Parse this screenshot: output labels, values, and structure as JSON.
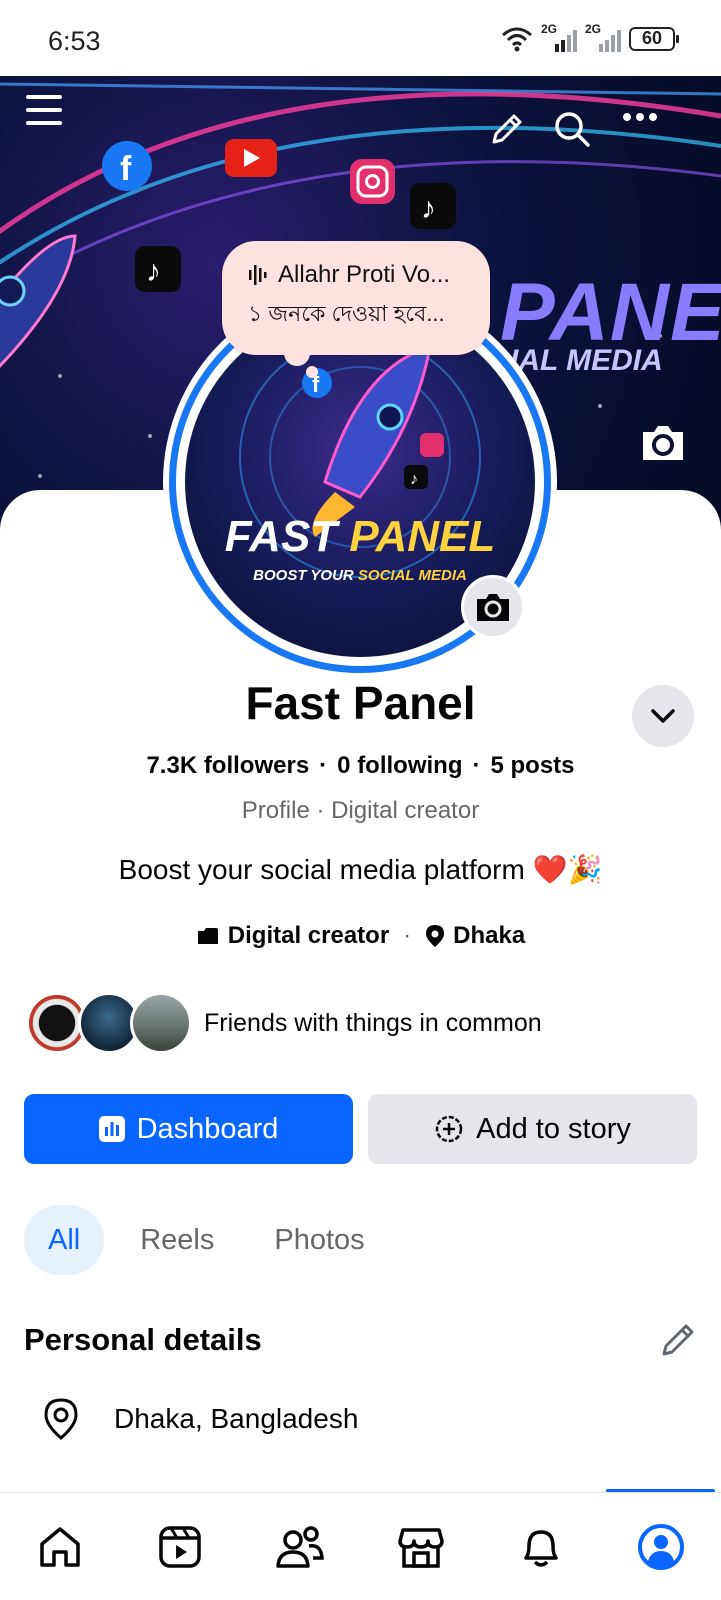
{
  "status_bar": {
    "time": "6:53",
    "signal_labels": [
      "2G",
      "2G"
    ],
    "battery": "60"
  },
  "cover": {
    "title": "PANEL",
    "subtitle": "IAL MEDIA",
    "icons": [
      "menu-icon",
      "edit-icon",
      "search-icon",
      "more-icon",
      "camera-icon"
    ]
  },
  "note": {
    "line1": "Allahr Proti Vo...",
    "line2": "১ জনকে দেওয়া হবে..."
  },
  "avatar": {
    "title_white": "FAST ",
    "title_yellow": "PANEL",
    "sub_white": "BOOST YOUR ",
    "sub_yellow": "SOCIAL MEDIA"
  },
  "profile": {
    "name": "Fast Panel",
    "followers": "7.3K followers",
    "following": "0 following",
    "posts": "5 posts",
    "category_line": "Profile · Digital creator",
    "bio": "Boost your social media platform ❤️🎉",
    "intro_category": "Digital creator",
    "intro_location": "Dhaka",
    "friends_text": "Friends with things in common"
  },
  "buttons": {
    "dashboard": "Dashboard",
    "add_story": "Add to story"
  },
  "tabs": [
    "All",
    "Reels",
    "Photos"
  ],
  "personal_details": {
    "title": "Personal details",
    "location": "Dhaka, Bangladesh"
  },
  "bottom_nav": [
    "home-icon",
    "reels-icon",
    "friends-icon",
    "marketplace-icon",
    "notifications-icon",
    "profile-icon"
  ],
  "colors": {
    "accent": "#0866ff",
    "ring": "#1877f2",
    "note_bg": "#fde2e0"
  }
}
